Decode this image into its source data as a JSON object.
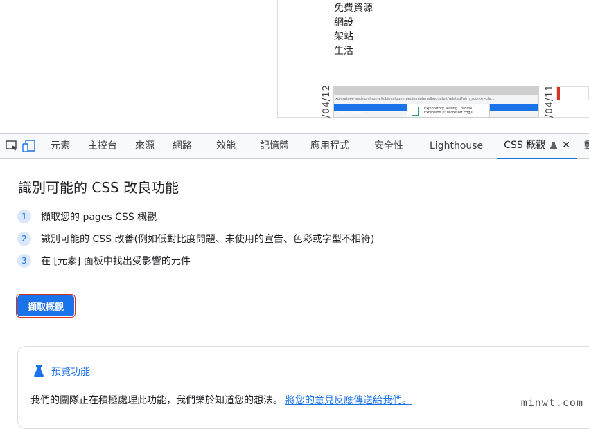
{
  "webpage": {
    "nav_items": [
      "免費資源",
      "網設",
      "架站",
      "生活"
    ],
    "date_left": "/04/12",
    "date_right": "/04/11",
    "thumb_url": "xploratory-testing-chrome/inbipmljpgmnpegjomlptemdbggnafplt/related?utm_source=chr...",
    "thumb_bar": "[新增至 Chrome]",
    "thumb_card_title": "Exploratory Testing Chrome",
    "thumb_card_sub": "Extension 於 Microsoft Edge"
  },
  "devtools": {
    "tabs": [
      "元素",
      "主控台",
      "來源",
      "網路",
      "效能",
      "記憶體",
      "應用程式",
      "安全性",
      "Lighthouse"
    ],
    "active_tab": "CSS 概觀",
    "overflow_tab": "動畫"
  },
  "main": {
    "heading": "識別可能的 CSS 改良功能",
    "steps": [
      {
        "num": "1",
        "text": "擷取您的 pages CSS 概觀"
      },
      {
        "num": "2",
        "text": "識別可能的 CSS 改善(例如低對比度問題、未使用的宣告、色彩或字型不相符)"
      },
      {
        "num": "3",
        "text": "在 [元素] 面板中找出受影響的元件"
      }
    ],
    "capture_button": "擷取概觀",
    "preview": {
      "title": "預覽功能",
      "message": "我們的團隊正在積極處理此功能，我們樂於知道您的想法。",
      "feedback_link": "將您的意見反應傳送給我們。"
    }
  },
  "watermark": "minwt.com",
  "colors": {
    "accent": "#1a73e8",
    "highlight_border": "#d93025"
  }
}
